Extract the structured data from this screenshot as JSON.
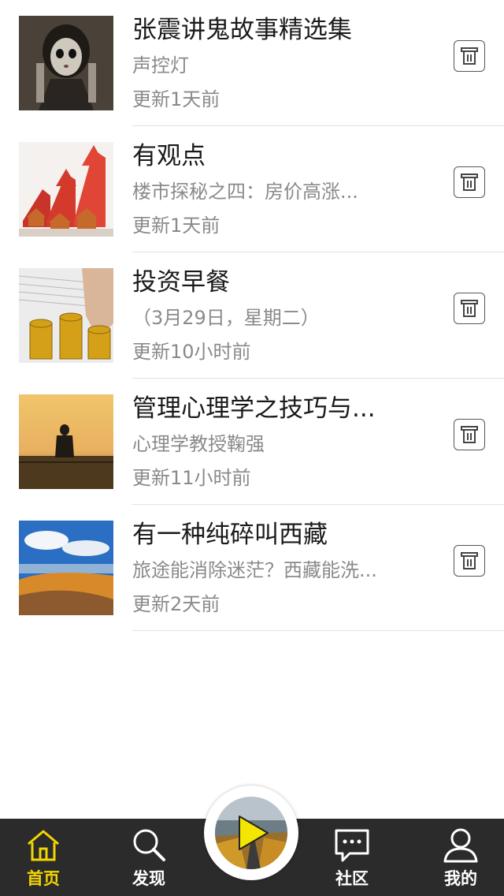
{
  "items": [
    {
      "title": "张震讲鬼故事精选集",
      "subtitle": "声控灯",
      "updated": "更新1天前",
      "thumb_icon": "ghost-girl-thumbnail"
    },
    {
      "title": "有观点",
      "subtitle": "楼市探秘之四：房价高涨...",
      "updated": "更新1天前",
      "thumb_icon": "housing-prices-thumbnail"
    },
    {
      "title": "投资早餐",
      "subtitle": "（3月29日，星期二）",
      "updated": "更新10小时前",
      "thumb_icon": "gold-coins-thumbnail"
    },
    {
      "title": "管理心理学之技巧与...",
      "subtitle": "心理学教授鞠强",
      "updated": "更新11小时前",
      "thumb_icon": "sunset-man-thumbnail"
    },
    {
      "title": "有一种纯碎叫西藏",
      "subtitle": "旅途能消除迷茫？西藏能洗...",
      "updated": "更新2天前",
      "thumb_icon": "tibet-landscape-thumbnail"
    }
  ],
  "tabbar": {
    "home": "首页",
    "discover": "发现",
    "community": "社区",
    "mine": "我的"
  },
  "colors": {
    "accent": "#f3d600",
    "tabbar_bg": "#2b2b2b",
    "divider": "#e1e1e1",
    "secondary_text": "#8a8a8a"
  }
}
